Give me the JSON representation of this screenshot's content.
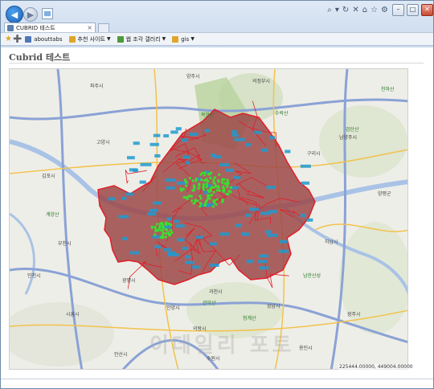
{
  "browser": {
    "tab_title": "CUBRID 테스트",
    "favorites": [
      {
        "label": "abouttabs",
        "color": "#4d78b8"
      },
      {
        "label": "추천 사이트",
        "color": "#e0a52a"
      },
      {
        "label": "웹 조각 갤러리",
        "color": "#4d9a3a"
      },
      {
        "label": "gis",
        "color": "#e0a52a"
      }
    ]
  },
  "page": {
    "heading": "Cubrid 테스트",
    "scale_text": "225444.00000, 449004.00000",
    "watermark": "이데일리 포토",
    "places": [
      {
        "label": "고양시"
      },
      {
        "label": "의정부시"
      },
      {
        "label": "남양주시"
      },
      {
        "label": "부천시"
      },
      {
        "label": "광명시"
      },
      {
        "label": "과천시"
      },
      {
        "label": "성남시"
      },
      {
        "label": "하남시"
      },
      {
        "label": "구리시"
      },
      {
        "label": "안양시"
      },
      {
        "label": "의왕시"
      },
      {
        "label": "인천시"
      },
      {
        "label": "김포시"
      },
      {
        "label": "파주시"
      },
      {
        "label": "양주시"
      },
      {
        "label": "양평군"
      },
      {
        "label": "광주시"
      },
      {
        "label": "시흥시"
      },
      {
        "label": "안산시"
      },
      {
        "label": "수원시"
      },
      {
        "label": "용인시"
      }
    ],
    "mountains": [
      {
        "label": "북한산"
      },
      {
        "label": "관악산"
      },
      {
        "label": "남한산성"
      },
      {
        "label": "청계산"
      },
      {
        "label": "계양산"
      },
      {
        "label": "수락산"
      },
      {
        "label": "천마산"
      },
      {
        "label": "검단산"
      }
    ]
  },
  "colors": {
    "seoul_fill": "#9c4848",
    "district_border": "#e01f2a",
    "marker": "#1f9bd0",
    "hotspot": "#38e02f",
    "road_major": "#8aa2d6",
    "road_minor": "#f2c24b",
    "river": "#a9c3e6"
  }
}
